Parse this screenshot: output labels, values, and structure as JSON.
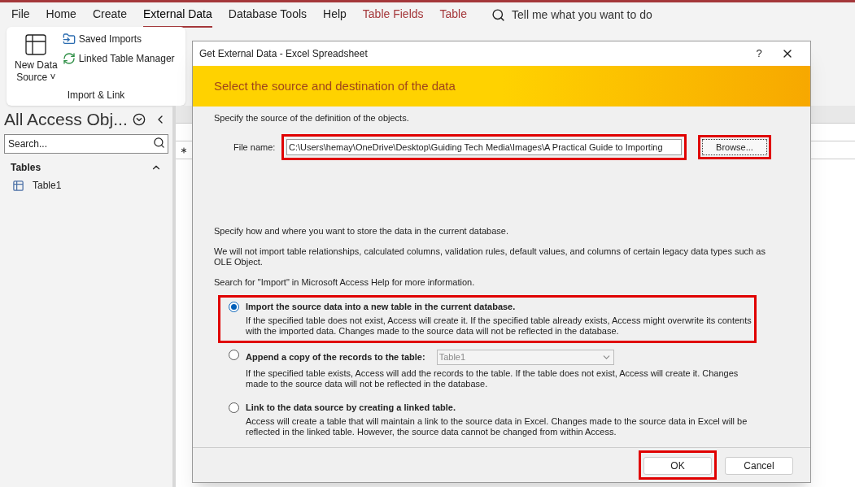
{
  "menu_tabs": [
    {
      "label": "File",
      "selected": false,
      "kind": "plain"
    },
    {
      "label": "Home",
      "selected": false,
      "kind": "plain"
    },
    {
      "label": "Create",
      "selected": false,
      "kind": "plain"
    },
    {
      "label": "External Data",
      "selected": true,
      "kind": "plain"
    },
    {
      "label": "Database Tools",
      "selected": false,
      "kind": "plain"
    },
    {
      "label": "Help",
      "selected": false,
      "kind": "plain"
    },
    {
      "label": "Table Fields",
      "selected": false,
      "kind": "context"
    },
    {
      "label": "Table",
      "selected": false,
      "kind": "context"
    }
  ],
  "tell_me": {
    "placeholder": "Tell me what you want to do"
  },
  "ribbon": {
    "new_data_source": [
      "New Data",
      "Source"
    ],
    "caret": "˅",
    "items": [
      "Saved Imports",
      "Linked Table Manager"
    ],
    "group_label": "Import & Link"
  },
  "nav_pane": {
    "title": "All Access Obj...",
    "search": {
      "placeholder": "Search..."
    },
    "section": "Tables",
    "items": [
      "Table1"
    ]
  },
  "dialog": {
    "title": "Get External Data - Excel Spreadsheet",
    "help": "?",
    "banner": "Select the source and destination of the data",
    "source_text": "Specify the source of the definition of the objects.",
    "file_label": "File name:",
    "file_value": "C:\\Users\\hemay\\OneDrive\\Desktop\\Guiding Tech Media\\Images\\A Practical Guide to Importing",
    "file_highlighted": true,
    "browse": {
      "label": "Browse...",
      "highlighted": true
    },
    "paragraphs": [
      "Specify how and where you want to store the data in the current database.",
      "We will not import table relationships, calculated columns, validation rules, default values, and columns of certain legacy data types such as OLE Object.",
      "Search for \"Import\" in Microsoft Access Help for more information."
    ],
    "options": [
      {
        "label": "Import the source data into a new table in the current database.",
        "selected": true,
        "highlighted": true,
        "description": "If the specified table does not exist, Access will create it. If the specified table already exists, Access might overwrite its contents with the imported data. Changes made to the source data will not be reflected in the database."
      },
      {
        "label": "Append a copy of the records to the table:",
        "selected": false,
        "highlighted": false,
        "table_select": "Table1",
        "description": "If the specified table exists, Access will add the records to the table. If the table does not exist, Access will create it. Changes made to the source data will not be reflected in the database."
      },
      {
        "label": "Link to the data source by creating a linked table.",
        "selected": false,
        "highlighted": false,
        "description": "Access will create a table that will maintain a link to the source data in Excel. Changes made to the source data in Excel will be reflected in the linked table. However, the source data cannot be changed from within Access."
      }
    ],
    "ok": {
      "label": "OK",
      "highlighted": true
    },
    "cancel": {
      "label": "Cancel",
      "highlighted": false
    }
  }
}
